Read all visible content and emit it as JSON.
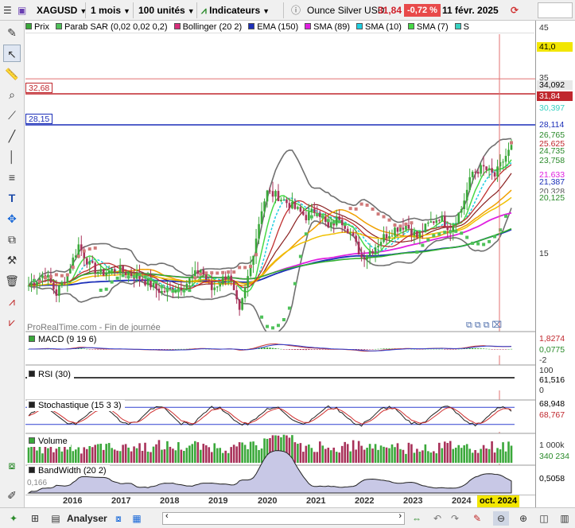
{
  "toolbar": {
    "symbol": "XAGUSD",
    "period": "1 mois",
    "units": "100 unités",
    "indicators_label": "Indicateurs",
    "instrument_name": "Ounce Silver USD",
    "last_price": "31,84",
    "change": "-0,72 %",
    "date": "11 févr. 2025"
  },
  "legend": [
    {
      "label": "Prix",
      "color": "#3aa83a"
    },
    {
      "label": "Parab SAR (0,02 0,02 0,2)",
      "color": "#4fc15a"
    },
    {
      "label": "Bollinger (20 2)",
      "color": "#d62e7a"
    },
    {
      "label": "EMA (150)",
      "color": "#1c2fb8"
    },
    {
      "label": "SMA (89)",
      "color": "#e020e0"
    },
    {
      "label": "SMA (10)",
      "color": "#20cfe0"
    },
    {
      "label": "SMA (7)",
      "color": "#46d846"
    },
    {
      "label": "S",
      "color": "#36d1c0"
    }
  ],
  "price_lines": {
    "upper": "32,68",
    "lower": "28,15"
  },
  "right_axis": {
    "price_ticks": [
      "45",
      "41,0",
      "35",
      "34,092",
      "31,84",
      "30,397",
      "28,114",
      "26,765",
      "25,625",
      "24,735",
      "23,758",
      "21,633",
      "21,387",
      "20,328",
      "20,125",
      "15"
    ],
    "macd": [
      "1,8274",
      "0,0775",
      "-2"
    ],
    "rsi": [
      "100",
      "61,516",
      "0"
    ],
    "stoch": [
      "68,948",
      "68,767"
    ],
    "volume": [
      "1 000k",
      "340 234"
    ],
    "bandwidth": [
      "0,5058"
    ]
  },
  "watermark": "ProRealTime.com - Fin de journée",
  "panels": {
    "macd": "MACD (9 19 6)",
    "rsi": "RSI (30)",
    "stoch": "Stochastique (15 3 3)",
    "volume": "Volume",
    "bandwidth": "BandWidth (20 2)",
    "bandwidth_value": "0,166"
  },
  "years": [
    "2016",
    "2017",
    "2018",
    "2019",
    "2020",
    "2021",
    "2022",
    "2023",
    "2024"
  ],
  "cursor_date": "oct. 2024",
  "statusbar": {
    "analyze_label": "Analyser"
  },
  "colors": {
    "up": "#3aa83a",
    "down": "#a8325a",
    "sar": "#4fc15a",
    "bollinger": "#707070",
    "ema150": "#1c2fb8",
    "sma89": "#e020e0",
    "red_line": "#c0272d",
    "blue_line": "#1c2fb8"
  }
}
